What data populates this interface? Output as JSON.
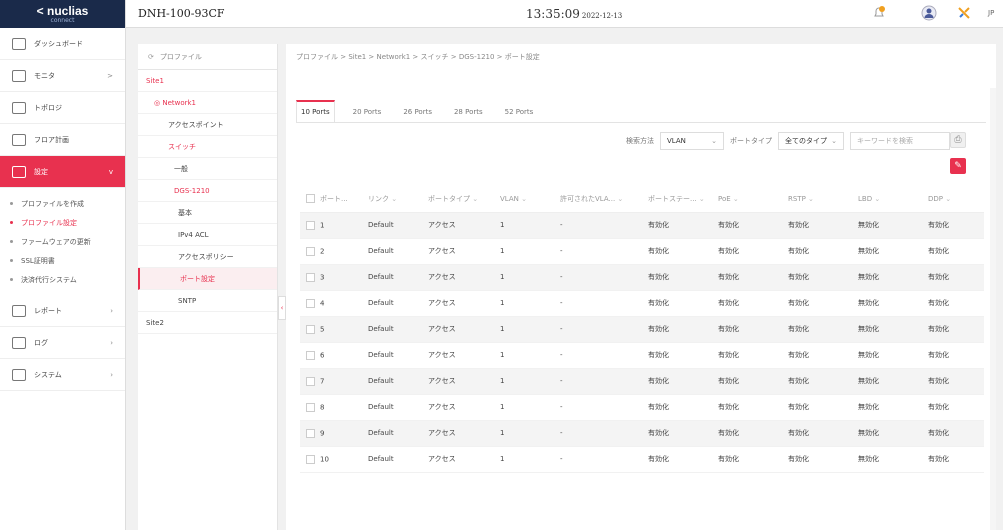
{
  "brand": {
    "name": "< nuclias",
    "sub": "connect"
  },
  "header": {
    "device": "DNH-100-93CF",
    "time": "13:35:09",
    "date": "2022-12-13",
    "lang": "JP"
  },
  "nav": [
    {
      "label": "ダッシュボード",
      "icon": "dashboard-icon",
      "chev": ""
    },
    {
      "label": "モニタ",
      "icon": "monitor-icon",
      "chev": ">"
    },
    {
      "label": "トポロジ",
      "icon": "topology-icon",
      "chev": ""
    },
    {
      "label": "フロア計画",
      "icon": "floorplan-icon",
      "chev": ""
    },
    {
      "label": "設定",
      "icon": "settings-icon",
      "chev": "v",
      "active": true
    }
  ],
  "settings_sub": [
    {
      "label": "プロファイルを作成"
    },
    {
      "label": "プロファイル設定",
      "active": true
    },
    {
      "label": "ファームウェアの更新"
    },
    {
      "label": "SSL証明書"
    },
    {
      "label": "決済代行システム"
    }
  ],
  "nav_bottom": [
    {
      "label": "レポート",
      "icon": "report-icon"
    },
    {
      "label": "ログ",
      "icon": "log-icon"
    },
    {
      "label": "システム",
      "icon": "system-icon"
    }
  ],
  "tree": {
    "title": "プロファイル",
    "rows": [
      {
        "label": "Site1",
        "indent": 8,
        "style": "red"
      },
      {
        "label": "◎ Network1",
        "indent": 16,
        "style": "red"
      },
      {
        "label": "アクセスポイント",
        "indent": 30,
        "style": ""
      },
      {
        "label": "スイッチ",
        "indent": 30,
        "style": "red"
      },
      {
        "label": "一般",
        "indent": 36,
        "style": ""
      },
      {
        "label": "DGS-1210",
        "indent": 36,
        "style": "red"
      },
      {
        "label": "基本",
        "indent": 40,
        "style": ""
      },
      {
        "label": "IPv4 ACL",
        "indent": 40,
        "style": ""
      },
      {
        "label": "アクセスポリシー",
        "indent": 40,
        "style": ""
      },
      {
        "label": "ポート設定",
        "indent": 40,
        "style": "sel"
      },
      {
        "label": "SNTP",
        "indent": 40,
        "style": ""
      },
      {
        "label": "Site2",
        "indent": 8,
        "style": ""
      }
    ]
  },
  "breadcrumb": "プロファイル > Site1 > Network1 > スイッチ > DGS-1210 > ポート設定",
  "tabs": [
    "10 Ports",
    "20 Ports",
    "26 Ports",
    "28 Ports",
    "52 Ports"
  ],
  "filters": {
    "search_method_label": "検索方法",
    "search_method_value": "VLAN",
    "port_type_label": "ポートタイプ",
    "port_type_value": "全てのタイプ",
    "search_placeholder": "キーワードを検索"
  },
  "table": {
    "headers": [
      "ポート...",
      "リンク",
      "ポートタイプ",
      "VLAN",
      "許可されたVLA...",
      "ポートステー...",
      "PoE",
      "RSTP",
      "LBD",
      "DDP"
    ],
    "rows": [
      [
        "1",
        "Default",
        "アクセス",
        "1",
        "-",
        "有効化",
        "有効化",
        "有効化",
        "無効化",
        "有効化"
      ],
      [
        "2",
        "Default",
        "アクセス",
        "1",
        "-",
        "有効化",
        "有効化",
        "有効化",
        "無効化",
        "有効化"
      ],
      [
        "3",
        "Default",
        "アクセス",
        "1",
        "-",
        "有効化",
        "有効化",
        "有効化",
        "無効化",
        "有効化"
      ],
      [
        "4",
        "Default",
        "アクセス",
        "1",
        "-",
        "有効化",
        "有効化",
        "有効化",
        "無効化",
        "有効化"
      ],
      [
        "5",
        "Default",
        "アクセス",
        "1",
        "-",
        "有効化",
        "有効化",
        "有効化",
        "無効化",
        "有効化"
      ],
      [
        "6",
        "Default",
        "アクセス",
        "1",
        "-",
        "有効化",
        "有効化",
        "有効化",
        "無効化",
        "有効化"
      ],
      [
        "7",
        "Default",
        "アクセス",
        "1",
        "-",
        "有効化",
        "有効化",
        "有効化",
        "無効化",
        "有効化"
      ],
      [
        "8",
        "Default",
        "アクセス",
        "1",
        "-",
        "有効化",
        "有効化",
        "有効化",
        "無効化",
        "有効化"
      ],
      [
        "9",
        "Default",
        "アクセス",
        "1",
        "-",
        "有効化",
        "有効化",
        "有効化",
        "無効化",
        "有効化"
      ],
      [
        "10",
        "Default",
        "アクセス",
        "1",
        "-",
        "有効化",
        "有効化",
        "有効化",
        "無効化",
        "有効化"
      ]
    ]
  },
  "colors": {
    "accent": "#e8314f",
    "brand_bg": "#1a2a4a"
  }
}
